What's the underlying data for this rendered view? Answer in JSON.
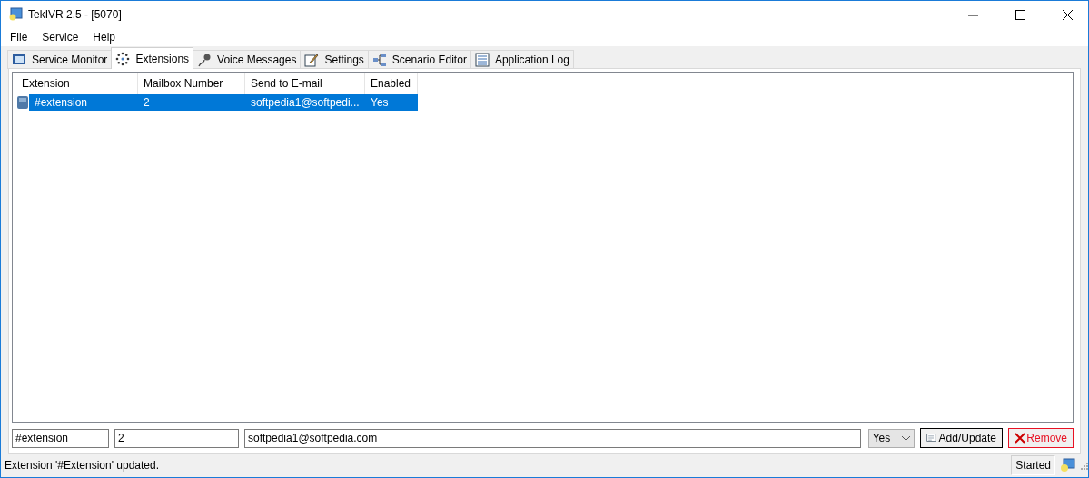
{
  "window": {
    "title": "TekIVR 2.5 - [5070]"
  },
  "menu": [
    "File",
    "Service",
    "Help"
  ],
  "tabs": [
    {
      "label": "Service Monitor",
      "selected": false
    },
    {
      "label": "Extensions",
      "selected": true
    },
    {
      "label": "Voice Messages",
      "selected": false
    },
    {
      "label": "Settings",
      "selected": false
    },
    {
      "label": "Scenario Editor",
      "selected": false
    },
    {
      "label": "Application Log",
      "selected": false
    }
  ],
  "table": {
    "columns": [
      "Extension",
      "Mailbox Number",
      "Send to E-mail",
      "Enabled"
    ],
    "rows": [
      {
        "selected": true,
        "cells": [
          "#extension",
          "2",
          "softpedia1@softpedi...",
          "Yes"
        ]
      }
    ]
  },
  "form": {
    "extension": "#extension",
    "mailbox": "2",
    "email": "softpedia1@softpedia.com",
    "enabled": "Yes",
    "add_button": "Add/Update",
    "remove_button": "Remove"
  },
  "status_bar": {
    "message": "Extension '#Extension' updated.",
    "state": "Started"
  }
}
